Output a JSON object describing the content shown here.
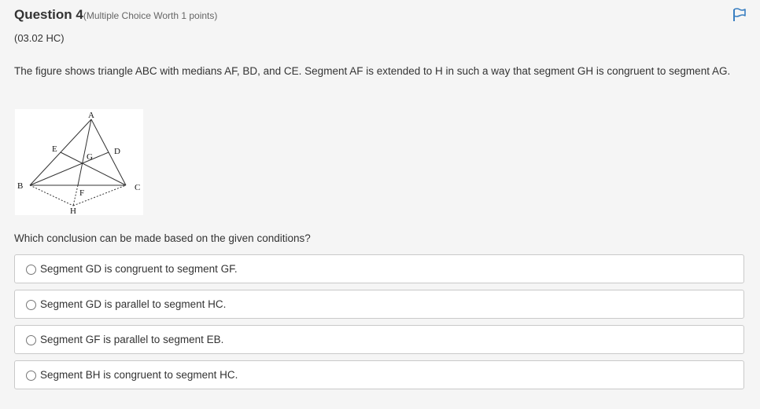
{
  "question": {
    "title": "Question 4",
    "meta": "(Multiple Choice Worth 1 points)",
    "code": "(03.02 HC)",
    "prompt": "The figure shows triangle ABC with medians AF, BD, and CE. Segment AF is extended to H in such a way that segment GH is congruent to segment AG.",
    "ask": "Which conclusion can be made based on the given conditions?"
  },
  "figure": {
    "labels": {
      "A": "A",
      "B": "B",
      "C": "C",
      "D": "D",
      "E": "E",
      "F": "F",
      "G": "G",
      "H": "H"
    }
  },
  "choices": [
    {
      "label": "Segment GD is congruent to segment GF."
    },
    {
      "label": "Segment GD is parallel to segment HC."
    },
    {
      "label": "Segment GF is parallel to segment EB."
    },
    {
      "label": "Segment BH is congruent to segment HC."
    }
  ],
  "icons": {
    "flag": "flag-icon"
  },
  "colors": {
    "accent": "#3a7fc1",
    "border": "#c9c9c9"
  }
}
